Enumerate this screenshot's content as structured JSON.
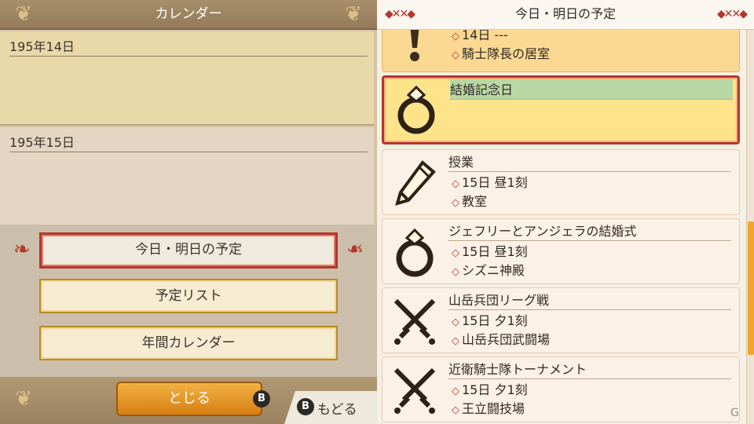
{
  "left": {
    "header_title": "カレンダー",
    "days": [
      {
        "date": "195年14日"
      },
      {
        "date": "195年15日"
      }
    ],
    "menu": [
      {
        "label": "今日・明日の予定"
      },
      {
        "label": "予定リスト"
      },
      {
        "label": "年間カレンダー"
      }
    ],
    "close_label": "とじる",
    "close_button_key": "B",
    "back_key": "B",
    "back_label": "もどる"
  },
  "right": {
    "header_title": "今日・明日の予定",
    "events": [
      {
        "icon": "exclamation-icon",
        "title": "",
        "lines": [
          "14日 ---",
          "騎士隊長の居室"
        ]
      },
      {
        "icon": "ring-icon",
        "title": "結婚記念日",
        "lines": []
      },
      {
        "icon": "pencil-icon",
        "title": "授業",
        "lines": [
          "15日 昼1刻",
          "教室"
        ]
      },
      {
        "icon": "ring-icon",
        "title": "ジェフリーとアンジェラの結婚式",
        "lines": [
          "15日 昼1刻",
          "シズニ神殿"
        ]
      },
      {
        "icon": "crossed-swords-icon",
        "title": "山岳兵団リーグ戦",
        "lines": [
          "15日 夕1刻",
          "山岳兵団武闘場"
        ]
      },
      {
        "icon": "crossed-swords-icon",
        "title": "近衛騎士隊トーナメント",
        "lines": [
          "15日 夕1刻",
          "王立闘技場"
        ]
      }
    ]
  },
  "watermark": "G",
  "colors": {
    "accent_red": "#b3372c",
    "gold": "#f0a52f",
    "selected_fill": "#fde48a"
  }
}
